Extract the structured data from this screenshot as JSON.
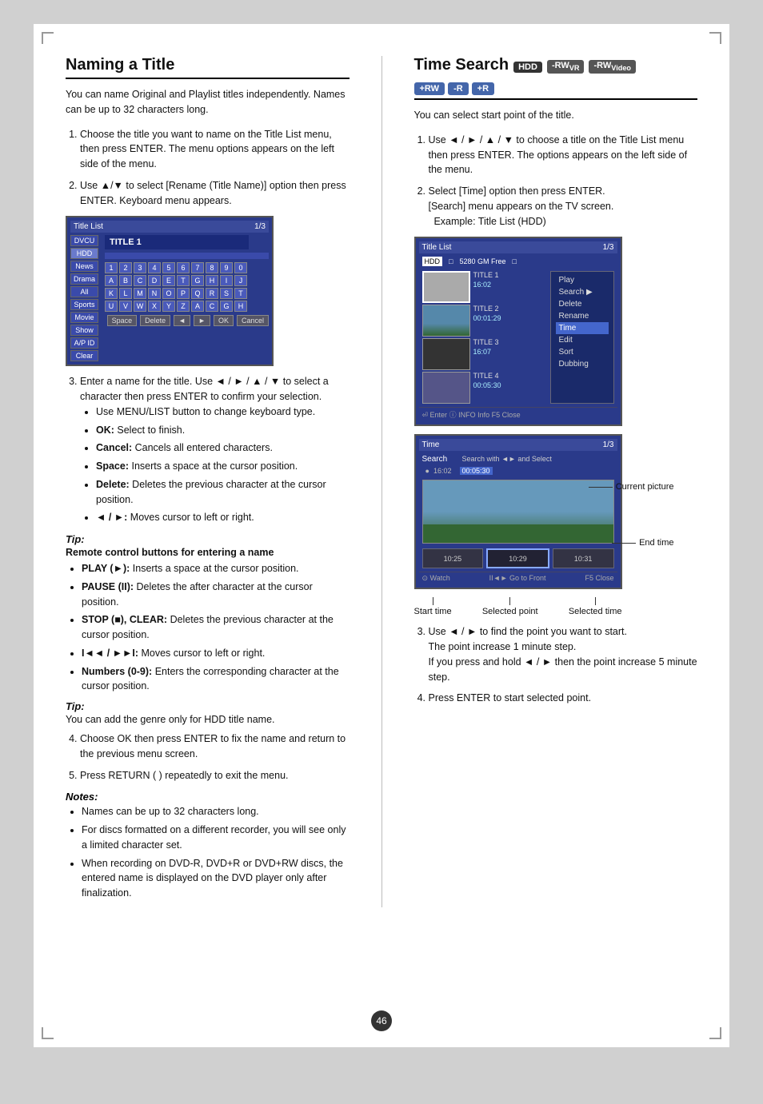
{
  "page": {
    "number": "46",
    "background": "#d0d0d0"
  },
  "left": {
    "title": "Naming a Title",
    "intro": "You can name Original and Playlist titles independently. Names can be up to 32 characters long.",
    "steps": [
      {
        "id": 1,
        "text": "Choose the title you want to name on the Title List menu, then press ENTER. The menu options appears on the left side of the menu."
      },
      {
        "id": 2,
        "text": "Use ▲/▼ to select [Rename (Title Name)] option then press ENTER. Keyboard menu appears."
      },
      {
        "id": 3,
        "text": "Enter a name for the title. Use ◄ / ► / ▲ / ▼ to select a character then press ENTER to confirm your selection."
      },
      {
        "id": 4,
        "text": "Choose OK then press ENTER to fix the name and return to the previous menu screen."
      },
      {
        "id": 5,
        "text": "Press RETURN (  ) repeatedly to exit the menu."
      }
    ],
    "bullets_step3": [
      "Use MENU/LIST button to change keyboard type.",
      "OK: Select to finish.",
      "Cancel: Cancels all entered characters.",
      "Space: Inserts a space at the cursor position.",
      "Delete: Deletes the previous character at the cursor position.",
      "◄ / ►: Moves cursor to left or right."
    ],
    "tip1_label": "Tip:",
    "tip1_heading": "Remote control buttons for entering a name",
    "tip1_items": [
      "PLAY (►): Inserts a space at the cursor position.",
      "PAUSE (II): Deletes the after character at the cursor position.",
      "STOP (■), CLEAR: Deletes the previous character at the cursor position.",
      "I◄◄ / ►►I: Moves cursor to left or right.",
      "Numbers (0-9): Enters the corresponding character at the cursor position."
    ],
    "tip2_label": "Tip:",
    "tip2_text": "You can add the genre only for HDD title name.",
    "notes_label": "Notes:",
    "notes_items": [
      "Names can be up to 32 characters long.",
      "For discs formatted on a different recorder, you will see only a limited character set.",
      "When recording on DVD-R, DVD+R or DVD+RW discs, the entered name is displayed on the DVD player only after finalization."
    ],
    "title_list_mockup": {
      "header": "Title List",
      "page": "1/3",
      "title_name": "TITLE 1",
      "left_items": [
        "DVCU",
        "HDD",
        "News",
        "Drama",
        "All",
        "Sports",
        "Movie",
        "Show",
        "A/P ID",
        "Clear"
      ],
      "keyboard_rows": [
        [
          "1",
          "2",
          "3",
          "4",
          "5",
          "6",
          "7",
          "8",
          "9",
          "0"
        ],
        [
          "A",
          "B",
          "C",
          "D",
          "E",
          "T",
          "G",
          "H",
          "I",
          "J"
        ],
        [
          "K",
          "L",
          "M",
          "N",
          "O",
          "P",
          "Q",
          "R",
          "S",
          "T"
        ],
        [
          "U",
          "V",
          "W",
          "X",
          "Y",
          "Z",
          "A",
          "C",
          "G",
          "H"
        ]
      ],
      "control_btns": [
        "Space",
        "Delete",
        "◄",
        "►",
        "OK",
        "Cancel"
      ]
    }
  },
  "right": {
    "title": "Time Search",
    "badges": [
      "HDD",
      "-RWVR",
      "-RWVideo",
      "+RW",
      "-R",
      "+R"
    ],
    "intro": "You can select start point of the title.",
    "steps": [
      {
        "id": 1,
        "text": "Use ◄ / ► / ▲ / ▼ to choose a title on the Title List menu then press ENTER. The options appears on the left side of the menu."
      },
      {
        "id": 2,
        "text": "Select [Time] option then press ENTER. [Search] menu appears on the TV screen. Example: Title List (HDD)"
      },
      {
        "id": 3,
        "text": "Use ◄ / ► to find the point you want to start. The point increase 1 minute step. If you press and hold ◄ / ► then the point increase 5 minute step."
      },
      {
        "id": 4,
        "text": "Press ENTER to start selected point."
      }
    ],
    "title_list_mockup": {
      "header": "Title List",
      "page": "1/3",
      "hdd_label": "HDD",
      "hdd_free": "5280 GM Free",
      "titles": [
        {
          "label": "TITLE 1",
          "time": "16:02"
        },
        {
          "label": "TITLE 2",
          "time": "00:01:29"
        },
        {
          "label": "TITLE 3",
          "time": "16:07"
        },
        {
          "label": "TITLE 4",
          "time": "00:05:30"
        }
      ],
      "menu_items": [
        "Play",
        "Search",
        "Delete",
        "Rename",
        "Edit",
        "Sort",
        "Dubbing"
      ],
      "menu_selected": "Time",
      "footer_enter": "Enter",
      "footer_info": "INFO Info",
      "footer_close": "Close"
    },
    "time_search_mockup": {
      "header": "Time",
      "search_label": "Search",
      "instructions": "Search with ◄► and Select",
      "time_options": [
        "16:02",
        "00:05:30"
      ],
      "time_selected": "00:05:30",
      "slider_items": [
        "10:25",
        "10:29",
        "10:31"
      ],
      "footer_watch": "Watch",
      "footer_fast": "II◄► Go to Front",
      "footer_close": "Close"
    },
    "annotations": {
      "current_picture": "Current picture",
      "end_time": "End time",
      "start_time": "Start time",
      "selected_time": "Selected time",
      "selected_point": "Selected point"
    }
  }
}
